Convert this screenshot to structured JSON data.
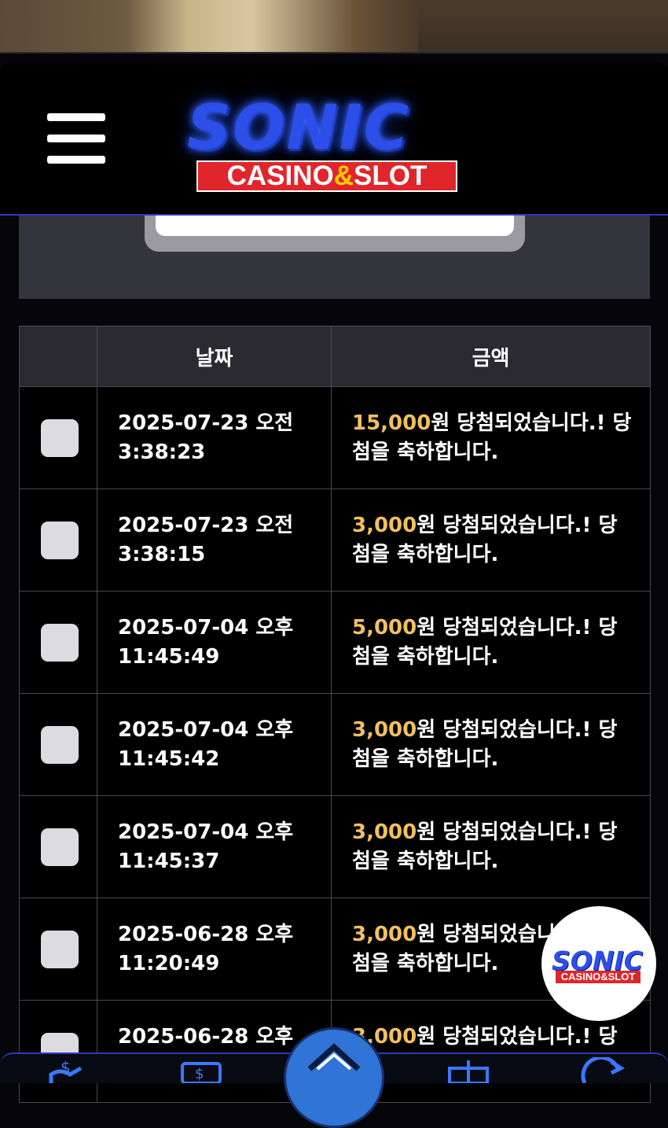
{
  "brand": {
    "name": "SONIC",
    "tagline_left": "CASINO",
    "tagline_amp": "&",
    "tagline_right": "SLOT"
  },
  "table": {
    "headers": [
      "",
      "날짜",
      "금액"
    ],
    "rows": [
      {
        "date": "2025-07-23 오전\n3:38:23",
        "amount": "15,000",
        "message": "원 당첨되었습니다.! 당첨을 축하합니다."
      },
      {
        "date": "2025-07-23 오전\n3:38:15",
        "amount": "3,000",
        "message": "원 당첨되었습니다.! 당첨을 축하합니다."
      },
      {
        "date": "2025-07-04 오후\n11:45:49",
        "amount": "5,000",
        "message": "원 당첨되었습니다.! 당첨을 축하합니다."
      },
      {
        "date": "2025-07-04 오후\n11:45:42",
        "amount": "3,000",
        "message": "원 당첨되었습니다.! 당첨을 축하합니다."
      },
      {
        "date": "2025-07-04 오후\n11:45:37",
        "amount": "3,000",
        "message": "원 당첨되었습니다.! 당첨을 축하합니다."
      },
      {
        "date": "2025-06-28 오후\n11:20:49",
        "amount": "3,000",
        "message": "원 당첨되었습니다.! 당첨을 축하합니다."
      },
      {
        "date": "2025-06-28 오후\n11:20:41",
        "amount": "3,000",
        "message": "원 당첨되었습니다.! 당첨을 축하합니다."
      }
    ]
  },
  "colors": {
    "amount": "#f0c060",
    "accent_blue": "#2b4fe8",
    "badge_red": "#e0262a"
  },
  "bottom_nav": {
    "icons": [
      "deposit-icon",
      "withdraw-icon",
      "home-icon",
      "gift-icon",
      "history-icon"
    ]
  }
}
